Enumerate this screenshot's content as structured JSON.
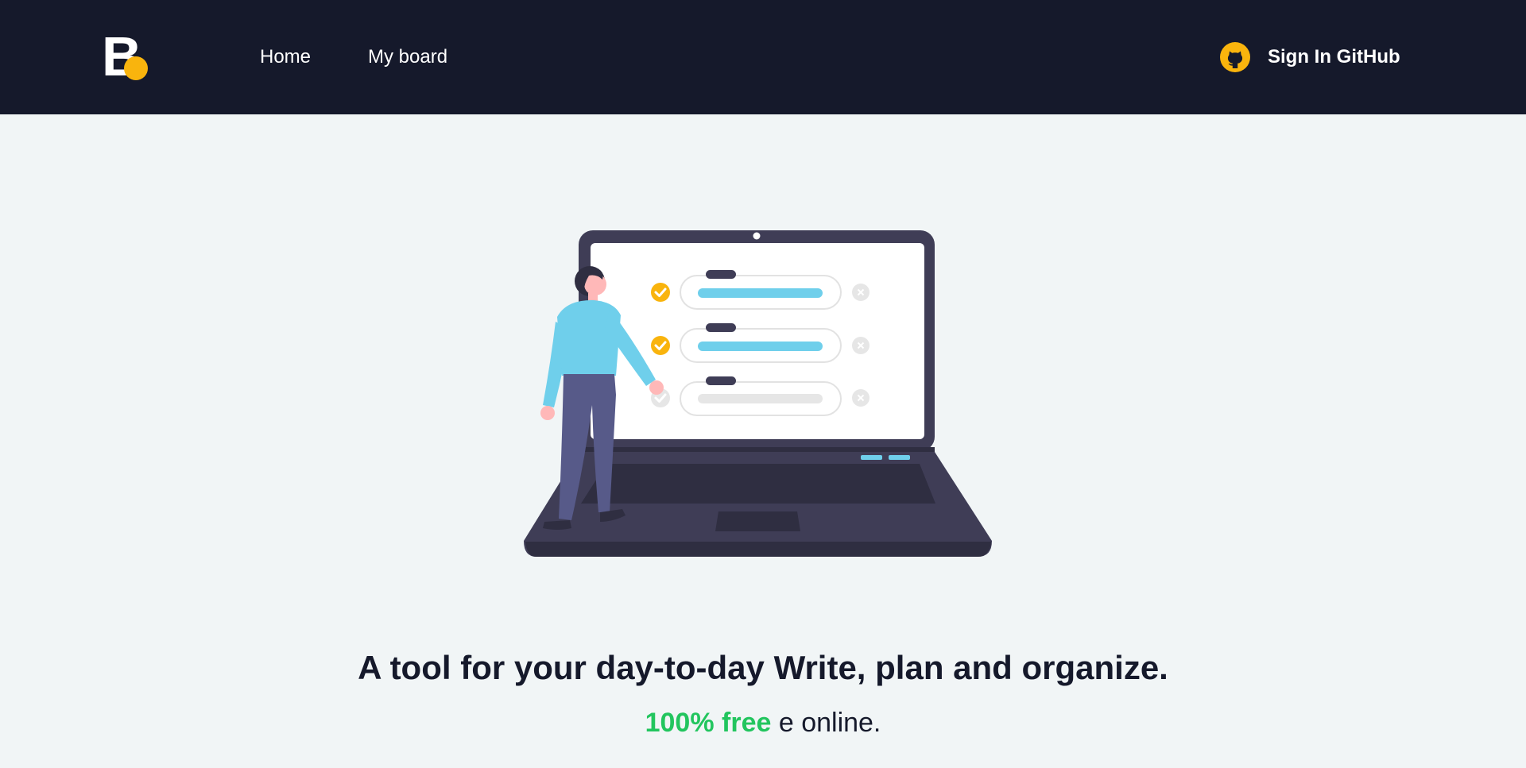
{
  "header": {
    "logo_letter": "B",
    "logo_dot_color": "#f9b40d",
    "nav": [
      {
        "label": "Home"
      },
      {
        "label": "My board"
      }
    ],
    "signin": {
      "icon": "github-icon",
      "label": "Sign In GitHub"
    }
  },
  "hero": {
    "illustration": "person-at-laptop-checklist-illustration",
    "checklist": [
      {
        "checked": true
      },
      {
        "checked": true
      },
      {
        "checked": false
      }
    ]
  },
  "content": {
    "headline": "A tool for your day-to-day Write, plan and organize.",
    "subline_accent": "100% free",
    "subline_rest": " e online."
  },
  "colors": {
    "header_bg": "#15192b",
    "page_bg": "#f1f5f6",
    "accent_yellow": "#f9b40d",
    "accent_green": "#22c55e",
    "accent_blue": "#6fcfeb"
  }
}
